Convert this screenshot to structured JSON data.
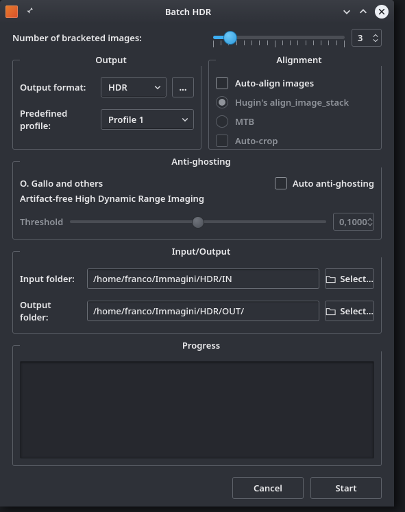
{
  "window": {
    "title": "Batch HDR"
  },
  "brackets": {
    "label": "Number of bracketed images:",
    "value": "3",
    "fill_pct": 13,
    "handle_pct": 13,
    "tick_count": 18
  },
  "output": {
    "legend": "Output",
    "format_label": "Output format:",
    "format_value": "HDR",
    "dots": "...",
    "profile_label": "Predefined profile:",
    "profile_value": "Profile 1"
  },
  "alignment": {
    "legend": "Alignment",
    "auto_align": "Auto-align images",
    "hugin": "Hugin's align_image_stack",
    "mtb": "MTB",
    "auto_crop": "Auto-crop"
  },
  "antighost": {
    "legend": "Anti-ghosting",
    "left1": "O. Gallo and others",
    "auto": "Auto anti-ghosting",
    "sub": "Artifact-free High Dynamic Range Imaging",
    "threshold_label": "Threshold",
    "threshold_value": "0,1000"
  },
  "io": {
    "legend": "Input/Output",
    "input_label": "Input folder:",
    "input_value": "/home/franco/Immagini/HDR/IN",
    "output_label": "Output folder:",
    "output_value": "/home/franco/Immagini/HDR/OUT/",
    "select": "Select..."
  },
  "progress": {
    "legend": "Progress"
  },
  "buttons": {
    "cancel": "Cancel",
    "start": "Start"
  }
}
